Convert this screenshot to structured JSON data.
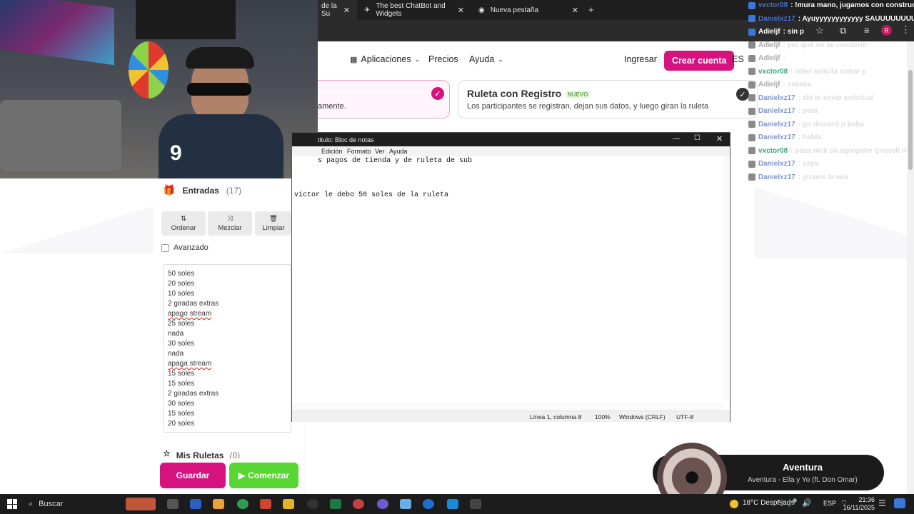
{
  "browser": {
    "tabs": [
      {
        "label": "de la Su"
      },
      {
        "label": "The best ChatBot and Widgets"
      },
      {
        "label": "Nueva pestaña"
      }
    ],
    "new_tab": "+",
    "profile_initial": "R"
  },
  "site": {
    "nav": {
      "apps": "Aplicaciones",
      "prices": "Precios",
      "help": "Ayuda",
      "login": "Ingresar",
      "signup": "Crear cuenta",
      "lang": "ES"
    },
    "card1": {
      "text": "amente."
    },
    "card2": {
      "title": "Ruleta con Registro",
      "badge": "NUEVO",
      "desc": "Los participantes se registran, dejan sus datos, y luego giran la ruleta"
    }
  },
  "panel": {
    "entries_title": "Entradas",
    "entries_count": "(17)",
    "buttons": {
      "sort": "Ordenar",
      "shuffle": "Mezclar",
      "clear": "Limpiar"
    },
    "advanced": "Avanzado",
    "entries": [
      "50 soles",
      "20 soles",
      "10 soles",
      "2 giradas extras",
      "apago stream",
      "25 soles",
      "nada",
      "30 soles",
      "nada",
      "apaga stream",
      "15 soles",
      "15 soles",
      "2 giradas extras",
      "30 soles",
      "15 soles",
      "20 soles"
    ],
    "my_wheels": "Mis Ruletas",
    "my_wheels_count": "(0)",
    "save": "Guardar",
    "start": "Comenzar"
  },
  "notepad": {
    "title": "titulo: Bloc de notas",
    "menu": [
      "Edición",
      "Formato",
      "Ver",
      "Ayuda"
    ],
    "lines": [
      "s pagos de tienda y de ruleta de sub",
      "",
      "",
      "victor le debo 50 soles de la ruleta"
    ],
    "status": {
      "pos": "Línea 1, columna 8",
      "zoom": "100%",
      "eol": "Windows (CRLF)",
      "enc": "UTF-8"
    }
  },
  "chat": [
    {
      "user": "vxctor08",
      "msg": ": !mura mano, jugamos con construc",
      "faded": false,
      "color": "#4a6fd1"
    },
    {
      "user": "Danielxz17",
      "msg": ": Ayuyyyyyyyyyyyy SAUUUUUUUUUU",
      "faded": false,
      "color": "#4a6fd1"
    },
    {
      "user": "Adieljf",
      "msg": ": sin p",
      "faded": false,
      "color": "#ffffff"
    },
    {
      "user": "Adieljf",
      "msg": ": por qué no se construir",
      "faded": true,
      "color": "#aaa"
    },
    {
      "user": "Adieljf",
      "msg": ": ",
      "faded": true,
      "color": "#aaa"
    },
    {
      "user": "vxctor08",
      "msg": ": adiel solicita entrar p",
      "faded": true,
      "color": "#3fa47e"
    },
    {
      "user": "Adieljf",
      "msg": ": vavava",
      "faded": true,
      "color": "#aaa"
    },
    {
      "user": "Danielxz17",
      "msg": ": ahi te envio solicitud",
      "faded": true,
      "color": "#7f95c9"
    },
    {
      "user": "Danielxz17",
      "msg": ": pera",
      "faded": true,
      "color": "#7f95c9"
    },
    {
      "user": "Danielxz17",
      "msg": ": go discord p beba",
      "faded": true,
      "color": "#7f95c9"
    },
    {
      "user": "Danielxz17",
      "msg": ": habla",
      "faded": true,
      "color": "#7f95c9"
    },
    {
      "user": "vxctor08",
      "msg": ": pasa nick pa agregarte q rusell no s",
      "faded": true,
      "color": "#3fa47e"
    },
    {
      "user": "Danielxz17",
      "msg": ": yaya",
      "faded": true,
      "color": "#7f95c9"
    },
    {
      "user": "Danielxz17",
      "msg": ": girame la mia",
      "faded": true,
      "color": "#7f95c9"
    }
  ],
  "music": {
    "title": "Aventura",
    "subtitle": "Aventura - Ella y Yo (ft. Don Omar)"
  },
  "taskbar": {
    "search": "Buscar",
    "weather": "18°C Despejado",
    "lang": "ESP",
    "time": "21:36",
    "date": "16/11/2025"
  },
  "colors": {
    "brand_pink": "#d6127f",
    "start_green": "#59d633"
  }
}
